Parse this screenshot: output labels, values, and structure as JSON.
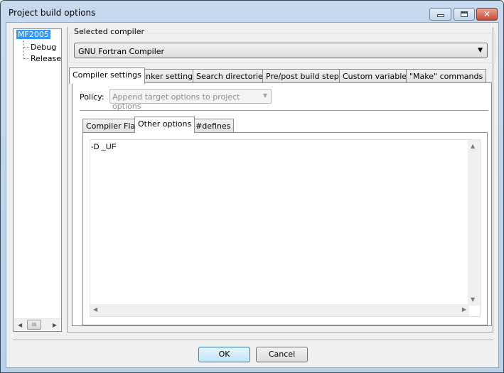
{
  "window": {
    "title": "Project build options",
    "controls": [
      "minimize-icon",
      "maximize-icon",
      "close-icon"
    ]
  },
  "tree": {
    "root": "MF2005",
    "children": [
      "Debug",
      "Release"
    ]
  },
  "compiler": {
    "group_label": "Selected compiler",
    "selected": "GNU Fortran Compiler"
  },
  "tabs": [
    "Compiler settings",
    "Linker settings",
    "Search directories",
    "Pre/post build steps",
    "Custom variables",
    "\"Make\" commands"
  ],
  "active_tab": "Compiler settings",
  "policy": {
    "label": "Policy:",
    "value": "Append target options to project options"
  },
  "inner_tabs": [
    "Compiler Flags",
    "Other options",
    "#defines"
  ],
  "active_inner_tab": "Other options",
  "editor": {
    "text": "-D _UF"
  },
  "buttons": {
    "ok": "OK",
    "cancel": "Cancel"
  }
}
